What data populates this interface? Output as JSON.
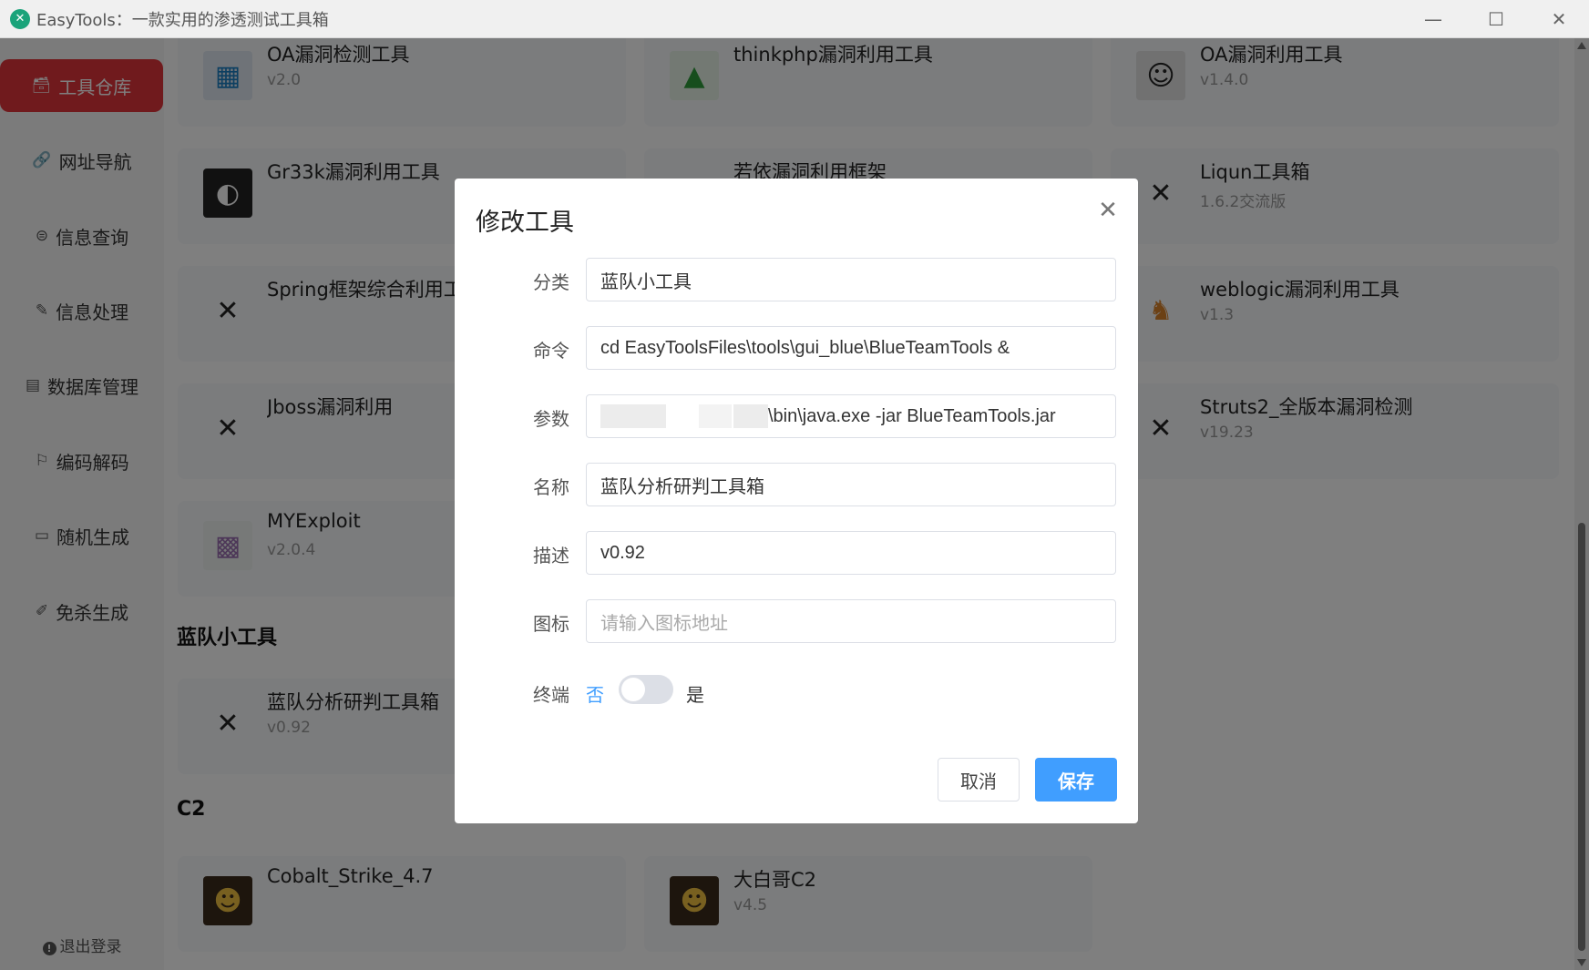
{
  "window": {
    "title": "EasyTools：一款实用的渗透测试工具箱",
    "app_icon": "✕"
  },
  "sidebar": {
    "items": [
      {
        "label": "工具仓库",
        "icon": "🗃"
      },
      {
        "label": "网址导航",
        "icon": "🔗"
      },
      {
        "label": "信息查询",
        "icon": "⊜"
      },
      {
        "label": "信息处理",
        "icon": "✎"
      },
      {
        "label": "数据库管理",
        "icon": "▤"
      },
      {
        "label": "编码解码",
        "icon": "⚐"
      },
      {
        "label": "随机生成",
        "icon": "▭"
      },
      {
        "label": "免杀生成",
        "icon": "✐"
      }
    ],
    "logout": "退出登录",
    "active_color": "#e0353b"
  },
  "main": {
    "cards": [
      {
        "name": "OA漏洞检测工具",
        "version": "v2.0",
        "icon": "▦"
      },
      {
        "name": "thinkphp漏洞利用工具",
        "version": "",
        "icon": "▲"
      },
      {
        "name": "OA漏洞利用工具",
        "version": "v1.4.0",
        "icon": "☺"
      },
      {
        "name": "Gr33k漏洞利用工具",
        "version": "",
        "icon": "◐"
      },
      {
        "name": "若依漏洞利用框架",
        "version": "",
        "icon": "✕"
      },
      {
        "name": "Liqun工具箱",
        "version": "1.6.2交流版",
        "icon": "✕"
      },
      {
        "name": "Spring框架综合利用工具",
        "version": "",
        "icon": "✕"
      },
      {
        "name": "weblogic漏洞利用工具",
        "version": "v1.3",
        "icon": "♞"
      },
      {
        "name": "Jboss漏洞利用",
        "version": "",
        "icon": "✕"
      },
      {
        "name": "Struts2_全版本漏洞检测",
        "version": "v19.23",
        "icon": "✕"
      },
      {
        "name": "MYExploit",
        "version": "v2.0.4",
        "icon": "▩"
      },
      {
        "name": "蓝队分析研判工具箱",
        "version": "v0.92",
        "icon": "✕"
      },
      {
        "name": "Cobalt_Strike_4.7",
        "version": "",
        "icon": "☻"
      },
      {
        "name": "大白哥C2",
        "version": "v4.5",
        "icon": "☻"
      }
    ],
    "sections": [
      "蓝队小工具",
      "C2"
    ]
  },
  "dialog": {
    "title": "修改工具",
    "fields": {
      "category": {
        "label": "分类",
        "value": "蓝队小工具"
      },
      "command": {
        "label": "命令",
        "value": "cd EasyToolsFiles\\tools\\gui_blue\\BlueTeamTools &"
      },
      "params": {
        "label": "参数",
        "value": "\\bin\\java.exe -jar BlueTeamTools.jar"
      },
      "name": {
        "label": "名称",
        "value": "蓝队分析研判工具箱"
      },
      "desc": {
        "label": "描述",
        "value": "v0.92"
      },
      "icon": {
        "label": "图标",
        "value": "",
        "placeholder": "请输入图标地址"
      },
      "terminal": {
        "label": "终端",
        "off": "否",
        "on": "是"
      }
    },
    "cancel": "取消",
    "save": "保存",
    "primary_color": "#409eff"
  }
}
